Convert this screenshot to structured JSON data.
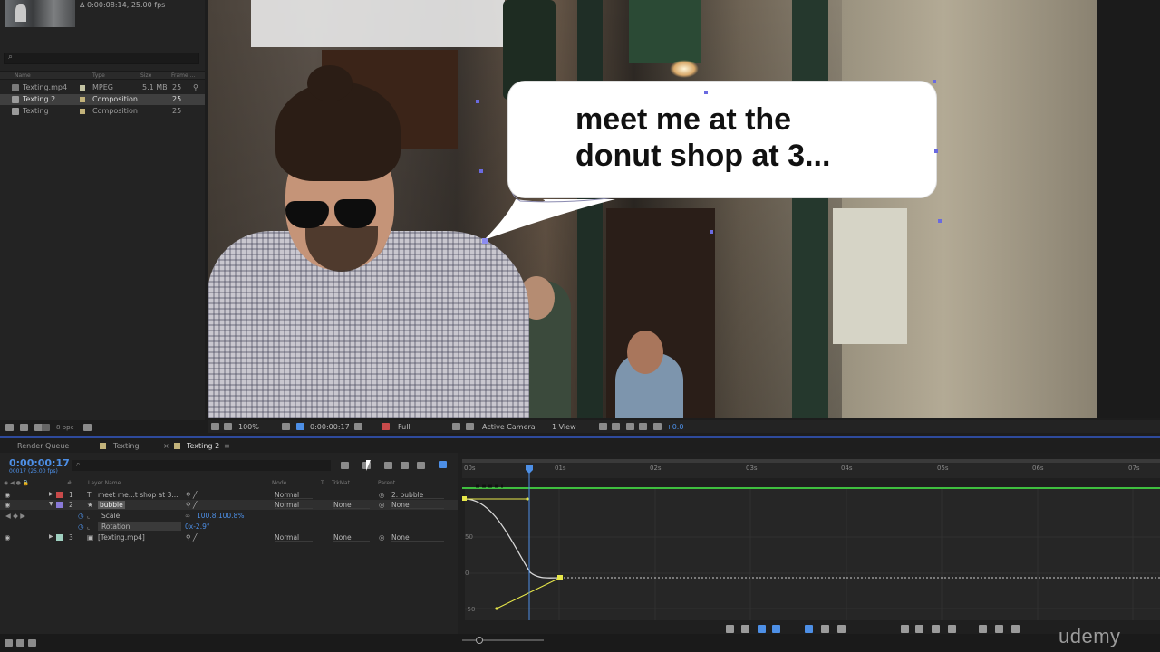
{
  "project": {
    "info": "Δ 0:00:08:14, 25.00 fps",
    "columns": [
      "Name",
      "Type",
      "Size",
      "Frame ..."
    ],
    "items": [
      {
        "name": "Texting.mp4",
        "type": "MPEG",
        "size": "5.1 MB",
        "fps": "25",
        "label_color": "#c2c2a2"
      },
      {
        "name": "Texting 2",
        "type": "Composition",
        "size": "",
        "fps": "25",
        "label_color": "#c2b27a"
      },
      {
        "name": "Texting",
        "type": "Composition",
        "size": "",
        "fps": "25",
        "label_color": "#c2b27a"
      }
    ],
    "bpc": "8 bpc"
  },
  "viewer": {
    "bubble_text": "meet me at the\ndonut shop at 3...",
    "zoom": "100%",
    "timecode": "0:00:00:17",
    "resolution": "Full",
    "camera": "Active Camera",
    "views": "1 View",
    "exposure": "+0.0"
  },
  "tabs": [
    {
      "label": "Render Queue",
      "color": ""
    },
    {
      "label": "Texting",
      "color": "#c2b27a"
    },
    {
      "label": "Texting 2",
      "color": "#c2b27a",
      "active": true
    }
  ],
  "timeline": {
    "timecode": "0:00:00:17",
    "timecode_sub": "00017 (25.00 fps)",
    "columns": {
      "layer_name": "Layer Name",
      "mode": "Mode",
      "t": "T",
      "trkmat": "TrkMat",
      "parent": "Parent"
    },
    "layers": [
      {
        "num": "1",
        "name": "meet me...t shop at 3...",
        "mode": "Normal",
        "trkmat": "",
        "parent": "2. bubble",
        "label_color": "#c84a4a",
        "type_icon": "T"
      },
      {
        "num": "2",
        "name": "bubble",
        "mode": "Normal",
        "trkmat": "None",
        "parent": "None",
        "label_color": "#8a7ad8",
        "type_icon": "★"
      },
      {
        "num": "3",
        "name": "[Texting.mp4]",
        "mode": "Normal",
        "trkmat": "None",
        "parent": "None",
        "label_color": "#9fd0c0",
        "type_icon": "▣"
      }
    ],
    "properties": [
      {
        "name": "Scale",
        "value": "100.8,100.8%"
      },
      {
        "name": "Rotation",
        "value": "0x-2.9°"
      }
    ],
    "ruler_labels": [
      "00s",
      "01s",
      "02s",
      "03s",
      "04s",
      "05s",
      "06s",
      "07s"
    ],
    "graph_labels": [
      "50",
      "0",
      "-50"
    ]
  },
  "watermark": "udemy",
  "colors": {
    "accent_blue": "#4d8fe6",
    "graph_yellow": "#e8e84a",
    "graph_curve": "#d8d8d8",
    "green_bar": "#3fbf3f"
  }
}
